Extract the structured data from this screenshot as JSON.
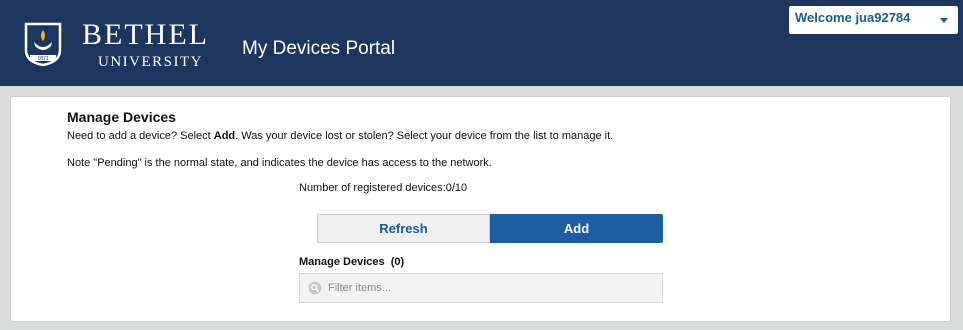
{
  "header": {
    "logo_name": "BETHEL",
    "logo_sub": "UNIVERSITY",
    "logo_year": "1871",
    "portal_title": "My Devices Portal",
    "welcome_label": "Welcome jua92784",
    "background": "#1d3660"
  },
  "manage": {
    "title": "Manage Devices",
    "intro_prefix": "Need to add a device? Select ",
    "intro_bold": "Add",
    "intro_suffix": ". Was your device lost or stolen? Select your device from the list to manage it.",
    "note": "Note \"Pending\" is the normal state, and indicates the device has access to the network.",
    "registered_count": "Number of registered devices:0/10",
    "refresh_label": "Refresh",
    "add_label": "Add",
    "devices_heading": "Manage Devices  (0)",
    "filter_placeholder": "Filter items..."
  },
  "icons": {
    "logo": "shield-lamp-icon",
    "welcome_caret": "caret-down-icon",
    "filter": "search-icon"
  },
  "colors": {
    "accent": "#1b5ea1",
    "link_text": "#1a5a96"
  }
}
